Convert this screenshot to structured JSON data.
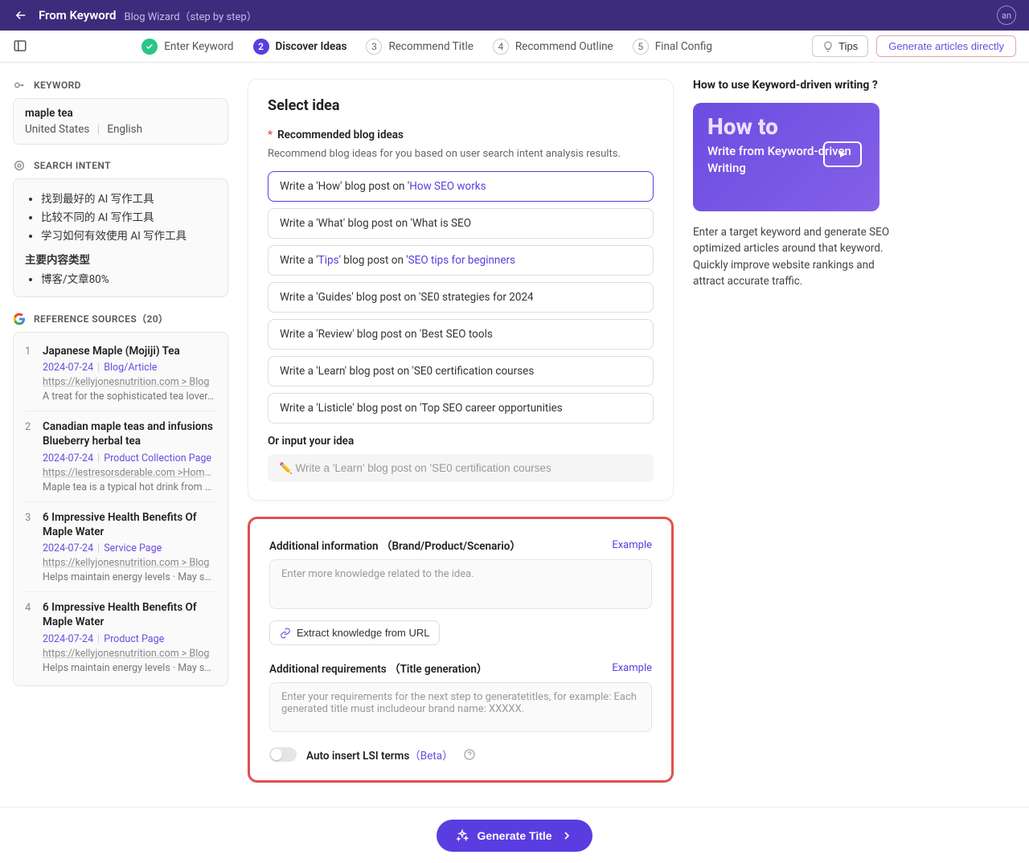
{
  "header": {
    "title": "From Keyword",
    "subtitle": "Blog Wizard（step by step）",
    "avatar": "an"
  },
  "stepbar": {
    "steps": [
      {
        "label": "Enter Keyword",
        "state": "done",
        "badge": "✓"
      },
      {
        "label": "Discover Ideas",
        "state": "active",
        "badge": "2"
      },
      {
        "label": "Recommend Title",
        "state": "pending",
        "badge": "3"
      },
      {
        "label": "Recommend Outline",
        "state": "pending",
        "badge": "4"
      },
      {
        "label": "Final Config",
        "state": "pending",
        "badge": "5"
      }
    ],
    "tips": "Tips",
    "generate_direct": "Generate articles directly"
  },
  "left": {
    "keyword_head": "KEYWORD",
    "keyword_value": "maple tea",
    "keyword_country": "United States",
    "keyword_lang": "English",
    "intent_head": "SEARCH INTENT",
    "intent_items": [
      "找到最好的 AI 写作工具",
      "比较不同的 AI 写作工具",
      "学习如何有效使用 AI 写作工具"
    ],
    "intent_subhead": "主要内容类型",
    "intent_sub_items": [
      "博客/文章80%"
    ],
    "refs_head": "REFERENCE SOURCES（20）",
    "refs": [
      {
        "n": "1",
        "title": "Japanese Maple (Mojiji) Tea",
        "date": "2024-07-24",
        "type": "Blog/Article",
        "url": "https://kellyjonesnutrition.com > Blog",
        "desc": "A treat for the sophisticated tea lover. Ma..."
      },
      {
        "n": "2",
        "title": "Canadian maple teas and infusions Blueberry herbal tea",
        "date": "2024-07-24",
        "type": "Product Collection Page",
        "url": "https://lestresorsderable.com >Home >Drinks",
        "desc": "Maple tea is a typical hot drink from Cana..."
      },
      {
        "n": "3",
        "title": "6 Impressive Health Benefits Of Maple Water",
        "date": "2024-07-24",
        "type": "Service Page",
        "url": "https://kellyjonesnutrition.com > Blog",
        "desc": "Helps maintain energy levels · May suppo..."
      },
      {
        "n": "4",
        "title": "6 Impressive Health Benefits Of Maple Water",
        "date": "2024-07-24",
        "type": "Product Page",
        "url": "https://kellyjonesnutrition.com > Blog",
        "desc": "Helps maintain energy levels · May suppo..."
      }
    ]
  },
  "main": {
    "select_idea_title": "Select idea",
    "rec_label": "Recommended blog ideas",
    "rec_hint": "Recommend blog ideas for you based on user search intent analysis results.",
    "ideas": [
      {
        "pre": "Write a 'How' blog post on '",
        "hl": "How SEO works",
        "selected": true
      },
      {
        "pre": "Write a 'What' blog post on '",
        "hl": "What is SEO",
        "selected": false,
        "plain": "Write a 'What' blog post on 'What is SEO"
      },
      {
        "pre": "Write a '",
        "mid1": "Tips",
        "mid2": "' blog post on '",
        "hl": "SEO tips for beginners",
        "selected": false,
        "styled": true
      },
      {
        "plain": "Write a 'Guides' blog post on 'SE0 strategies for 2024",
        "selected": false
      },
      {
        "plain": "Write a 'Review' blog post on 'Best SEO tools",
        "selected": false
      },
      {
        "plain": "Write a 'Learn' blog post on 'SE0 certification courses",
        "selected": false
      },
      {
        "plain": "Write a 'Listicle' blog post on 'Top SEO career opportunities",
        "selected": false
      }
    ],
    "or_label": "Or input your idea",
    "idea_placeholder": "✏️ Write a 'Learn' blog post on 'SE0 certification courses",
    "addl_info_label": "Additional information （Brand/Product/Scenario）",
    "example": "Example",
    "addl_info_placeholder": "Enter more knowledge related to the idea.",
    "extract_label": "Extract knowledge from URL",
    "addl_req_label": "Additional requirements （Title generation）",
    "addl_req_placeholder": "Enter your requirements for the next step to generatetitles, for example: Each generated title must includeour brand name: XXXXX.",
    "lsi_label": "Auto insert LSI terms",
    "lsi_beta": "（Beta）"
  },
  "right": {
    "head": "How to use Keyword-driven writing ?",
    "video_howto": "How to",
    "video_sub": "Write from Keyword-driven Writing",
    "desc": "Enter a target keyword and generate SEO optimized articles around that keyword. Quickly improve website rankings and attract accurate traffic."
  },
  "footer": {
    "generate_title": "Generate Title"
  }
}
